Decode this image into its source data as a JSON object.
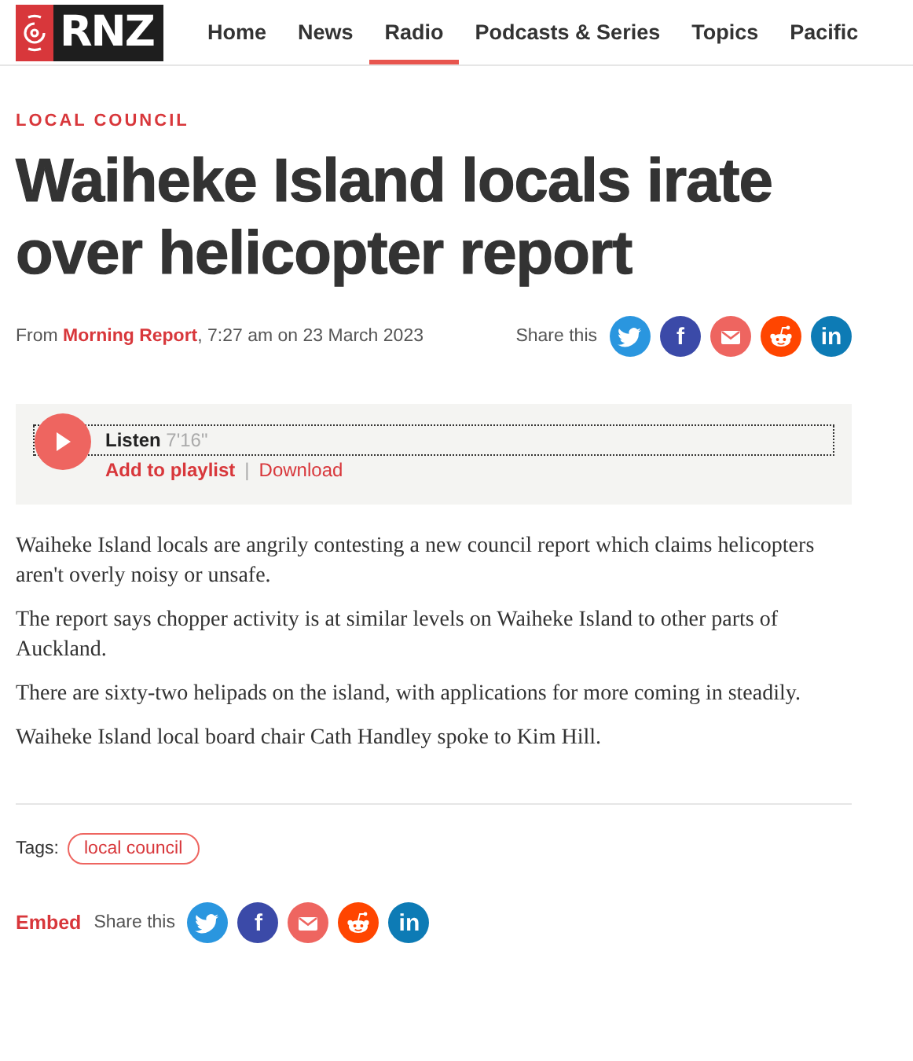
{
  "header": {
    "logo": "RNZ",
    "nav": [
      {
        "label": "Home",
        "selected": false
      },
      {
        "label": "News",
        "selected": false
      },
      {
        "label": "Radio",
        "selected": true
      },
      {
        "label": "Podcasts & Series",
        "selected": false
      },
      {
        "label": "Topics",
        "selected": false
      },
      {
        "label": "Pacific",
        "selected": false
      }
    ]
  },
  "article": {
    "category": "LOCAL COUNCIL",
    "headline": "Waiheke Island locals irate over helicopter report",
    "byline": {
      "from": "From",
      "programme": "Morning Report",
      "date": ", 7:27 am on 23 March 2023"
    },
    "share_top": {
      "label": "Share this",
      "buttons": [
        {
          "kind": "twitter",
          "color": "#2a96df"
        },
        {
          "kind": "facebook",
          "color": "#3b4aa8",
          "label": "f"
        },
        {
          "kind": "email",
          "color": "#ee6560"
        },
        {
          "kind": "reddit",
          "color": "#ff4500"
        },
        {
          "kind": "linkedin",
          "color": "#0d7bb5",
          "label": "in"
        }
      ]
    },
    "audio": {
      "listen": "Listen",
      "duration": "7'16\"",
      "add": "Add to playlist",
      "separator": "|",
      "download": "Download"
    },
    "paragraphs": [
      "Waiheke Island locals are angrily contesting a new council report which claims helicopters aren't overly noisy or unsafe.",
      "The report says chopper activity is at similar levels on Waiheke Island to other parts of Auckland.",
      "There are sixty-two helipads on the island, with applications for more coming in steadily.",
      "Waiheke Island local board chair Cath Handley spoke to Kim Hill."
    ],
    "tags": {
      "label": "Tags:",
      "items": [
        "local council"
      ]
    },
    "footer": {
      "embed": "Embed",
      "share": {
        "label": "Share this",
        "buttons": [
          {
            "kind": "twitter",
            "color": "#2a96df"
          },
          {
            "kind": "facebook",
            "color": "#3b4aa8",
            "label": "f"
          },
          {
            "kind": "email",
            "color": "#ee6560"
          },
          {
            "kind": "reddit",
            "color": "#ff4500"
          },
          {
            "kind": "linkedin",
            "color": "#0d7bb5",
            "label": "in"
          }
        ]
      }
    }
  }
}
